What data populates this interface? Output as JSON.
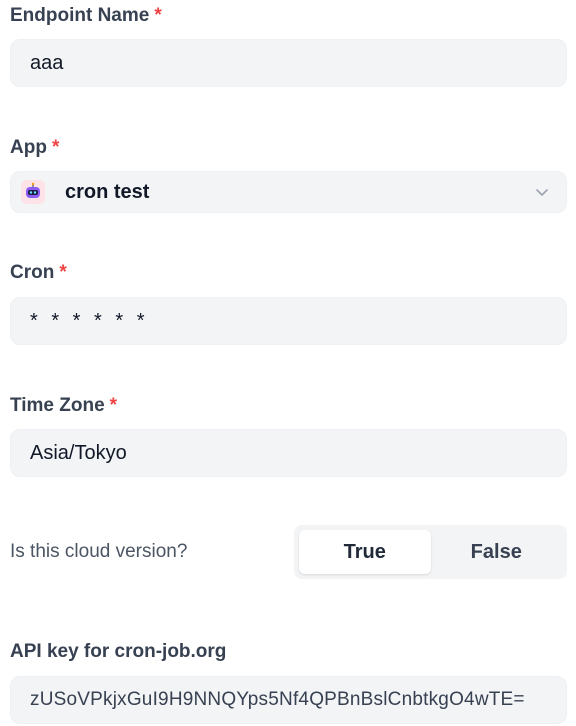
{
  "endpoint_name": {
    "label": "Endpoint Name",
    "required": "*",
    "value": "aaa"
  },
  "app": {
    "label": "App",
    "required": "*",
    "selected": "cron test",
    "icon": "robot-avatar-icon",
    "dropdown_icon": "chevron-down-icon"
  },
  "cron": {
    "label": "Cron",
    "required": "*",
    "value": "* * * * * *"
  },
  "time_zone": {
    "label": "Time Zone",
    "required": "*",
    "value": "Asia/Tokyo"
  },
  "cloud_version": {
    "question": "Is this cloud version?",
    "options": [
      "True",
      "False"
    ],
    "selected": "True"
  },
  "api_key": {
    "label": "API key for cron-job.org",
    "value": "zUSoVPkjxGuI9H9NNQYps5Nf4QPBnBslCnbtkgO4wTE="
  },
  "colors": {
    "required": "#ef4444",
    "field_bg": "#f3f4f6",
    "label": "#374151"
  }
}
